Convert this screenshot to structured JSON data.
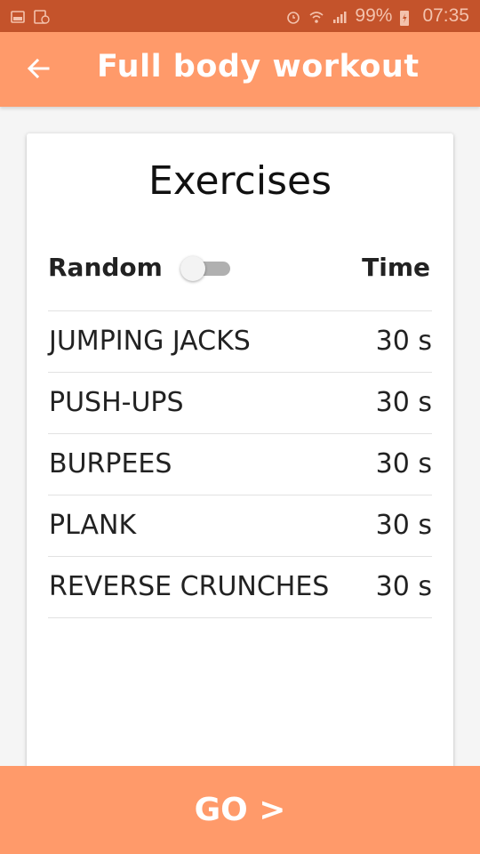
{
  "status_bar": {
    "battery": "99%",
    "time": "07:35",
    "icons": [
      "gallery-icon",
      "sim-icon",
      "alarm-icon",
      "wifi-icon",
      "signal-icon",
      "battery-icon"
    ]
  },
  "app_bar": {
    "back_icon": "arrow-left-icon",
    "title": "Full body workout"
  },
  "card": {
    "title": "Exercises",
    "random_label": "Random",
    "random_enabled": false,
    "time_label": "Time",
    "exercises": [
      {
        "name": "JUMPING JACKS",
        "time": "30 s"
      },
      {
        "name": "PUSH-UPS",
        "time": "30 s"
      },
      {
        "name": "BURPEES",
        "time": "30 s"
      },
      {
        "name": "PLANK",
        "time": "30 s"
      },
      {
        "name": "REVERSE CRUNCHES",
        "time": "30 s"
      }
    ]
  },
  "go_button": {
    "label": "GO >"
  },
  "colors": {
    "status_bar": "#c4532b",
    "accent": "#ff9a6a",
    "toggle_track": "#b0b0b0"
  }
}
